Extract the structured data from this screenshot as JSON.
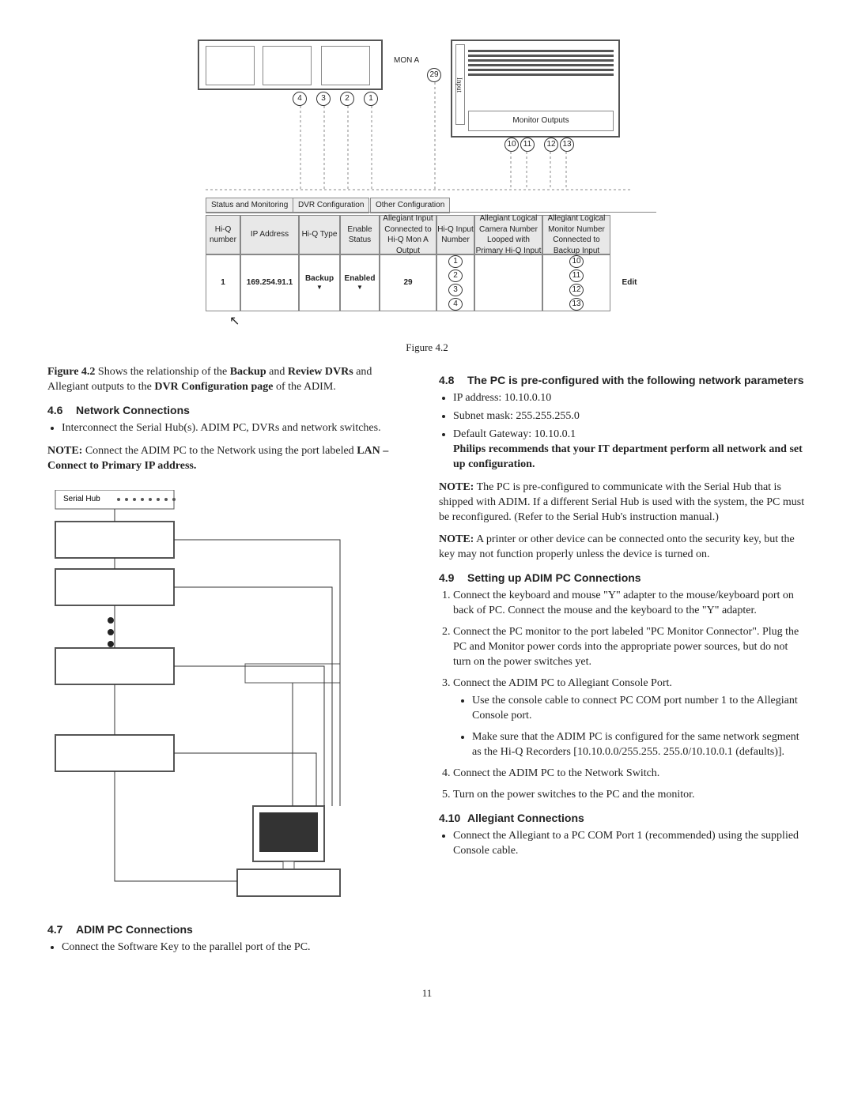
{
  "figure": {
    "caption": "Figure 4.2",
    "mon_label": "MON A",
    "mon_num": "29",
    "top_nums": [
      "4",
      "3",
      "2",
      "1"
    ],
    "monitor_outputs_label": "Monitor Outputs",
    "out_nums": [
      "10",
      "11",
      "12",
      "13"
    ],
    "tabs": [
      "Status and Monitoring",
      "DVR Configuration",
      "Other Configuration"
    ],
    "headers": [
      "Hi-Q number",
      "IP Address",
      "Hi-Q Type",
      "Enable Status",
      "Allegiant Input Connected to Hi-Q Mon A Output",
      "Hi-Q Input Number",
      "Allegiant Logical Camera Number Looped with Primary Hi-Q Input",
      "Allegiant Logical Monitor Number Connected to Backup Input"
    ],
    "row": [
      "1",
      "169.254.91.1",
      "Backup",
      "Enabled",
      "29",
      "1",
      "",
      "10"
    ],
    "input_nums": [
      "1",
      "2",
      "3",
      "4"
    ],
    "backup_nums": [
      "10",
      "11",
      "12",
      "13"
    ],
    "edit_btn": "Edit"
  },
  "intro": {
    "prefix": "Figure 4.2",
    "mid1": " Shows the relationship of the ",
    "b1": "Backup",
    "mid2": " and ",
    "b2": "Review DVRs",
    "mid3": " and Allegiant outputs to the ",
    "b3": "DVR Configuration page",
    "mid4": " of the ADIM."
  },
  "s46": {
    "num": "4.6",
    "title": "Network Connections",
    "bullet1": "Interconnect the Serial Hub(s). ADIM PC, DVRs and network switches.",
    "note_label": "NOTE:",
    "note_a": "  Connect the ADIM PC to the  Network using the port labeled ",
    "note_b": "LAN – Connect to Primary IP address."
  },
  "diagram_left": {
    "serial_hub": "Serial Hub"
  },
  "s47": {
    "num": "4.7",
    "title": "ADIM PC Connections",
    "bullet1": "Connect the Software Key to the parallel port of the PC."
  },
  "s48": {
    "num": "4.8",
    "title": "The PC is pre-configured with the following network parameters",
    "b1": "IP address:   10.10.0.10",
    "b2": "Subnet mask:  255.255.255.0",
    "b3": "Default Gateway:   10.10.0.1",
    "rec": "Philips recommends that your IT department perform all network and set up configuration.",
    "note_label": "NOTE:",
    "note1": "  The PC is pre-configured to communicate with the Serial Hub that is shipped with ADIM. If a different Serial Hub is used with the system, the PC must be reconfigured. (Refer to the Serial Hub's instruction manual.)",
    "note2_label": "NOTE:",
    "note2": "  A printer or other device can be connected onto the security key, but the key may not function properly unless the device is turned on."
  },
  "s49": {
    "num": "4.9",
    "title": "Setting up ADIM PC Connections",
    "step1": "Connect the keyboard and mouse \"Y\" adapter to the mouse/keyboard port on back of PC.  Connect the mouse and the keyboard to the \"Y\" adapter.",
    "step2": "Connect the PC monitor to the port labeled \"PC Monitor Connector\". Plug the PC and Monitor power cords into the appropriate power sources, but do not turn on the power switches yet.",
    "step3": "Connect the ADIM PC to Allegiant Console Port.",
    "step3a": "Use the console cable to connect PC COM port number 1 to the Allegiant Console port.",
    "step3b": "Make sure that the ADIM PC is configured for the same network segment as the Hi-Q Recorders [10.10.0.0/255.255. 255.0/10.10.0.1 (defaults)].",
    "step4": "Connect the ADIM PC to the Network Switch.",
    "step5": "Turn on the power switches to the PC and the monitor."
  },
  "s410": {
    "num": "4.10",
    "title": "Allegiant Connections",
    "bullet1": "Connect the Allegiant to a PC COM Port 1 (recommended) using the supplied Console cable."
  },
  "page_num": "11"
}
